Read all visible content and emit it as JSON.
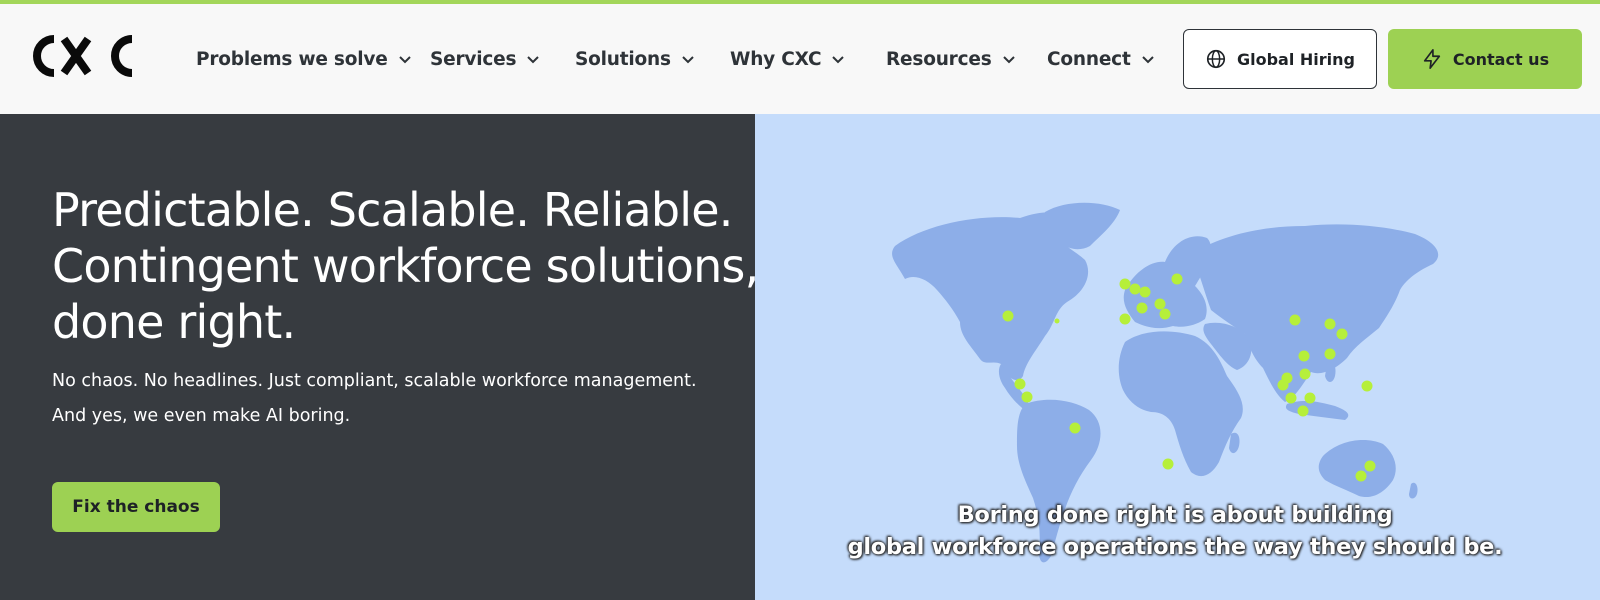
{
  "brand": {
    "logo_text": "CXC",
    "accent": "#a3d65a",
    "dark": "#373b40",
    "map_bg": "#c5dcfb",
    "land": "#8daee8",
    "dot": "#b6ef3a"
  },
  "nav": {
    "items": [
      {
        "label": "Problems we solve",
        "icon": "chevron-down-icon"
      },
      {
        "label": "Services",
        "icon": "chevron-down-icon"
      },
      {
        "label": "Solutions",
        "icon": "chevron-down-icon"
      },
      {
        "label": "Why CXC",
        "icon": "chevron-down-icon"
      },
      {
        "label": "Resources",
        "icon": "chevron-down-icon"
      },
      {
        "label": "Connect",
        "icon": "chevron-down-icon"
      }
    ],
    "global_hiring": {
      "label": "Global Hiring",
      "icon": "globe-icon"
    },
    "contact": {
      "label": "Contact us",
      "icon": "lightning-icon"
    }
  },
  "hero": {
    "headline_lines": [
      "Predictable. Scalable. Reliable.",
      "Contingent workforce solutions,",
      "done right."
    ],
    "sub_lines": [
      "No chaos. No headlines. Just compliant, scalable workforce management.",
      "And yes, we even make AI boring."
    ],
    "cta_label": "Fix the chaos",
    "caption_lines": [
      "Boring done right is about building",
      "global workforce operations the way they should be."
    ]
  }
}
